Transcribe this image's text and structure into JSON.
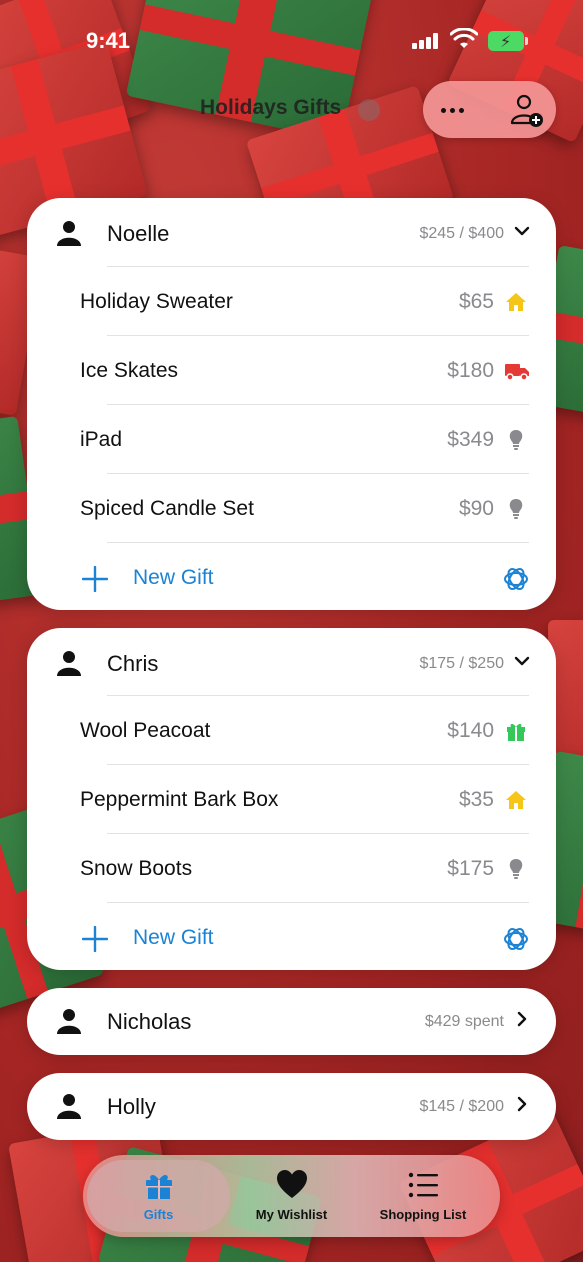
{
  "status_bar": {
    "time": "9:41"
  },
  "header": {
    "title": "Holidays Gifts"
  },
  "people": [
    {
      "name": "Noelle",
      "budget": "$245 / $400",
      "expanded": true,
      "gifts": [
        {
          "name": "Holiday Sweater",
          "price": "$65",
          "status_icon": "house-icon",
          "color": "#f5c518"
        },
        {
          "name": "Ice Skates",
          "price": "$180",
          "status_icon": "truck-icon",
          "color": "#e53935"
        },
        {
          "name": "iPad",
          "price": "$349",
          "status_icon": "lightbulb-icon",
          "color": "#8a8a8e"
        },
        {
          "name": "Spiced Candle Set",
          "price": "$90",
          "status_icon": "lightbulb-icon",
          "color": "#8a8a8e"
        }
      ],
      "new_gift_label": "New Gift"
    },
    {
      "name": "Chris",
      "budget": "$175 / $250",
      "expanded": true,
      "gifts": [
        {
          "name": "Wool Peacoat",
          "price": "$140",
          "status_icon": "gift-icon",
          "color": "#34c759"
        },
        {
          "name": "Peppermint Bark Box",
          "price": "$35",
          "status_icon": "house-icon",
          "color": "#f5c518"
        },
        {
          "name": "Snow Boots",
          "price": "$175",
          "status_icon": "lightbulb-icon",
          "color": "#8a8a8e"
        }
      ],
      "new_gift_label": "New Gift"
    },
    {
      "name": "Nicholas",
      "budget": "$429 spent",
      "expanded": false
    },
    {
      "name": "Holly",
      "budget": "$145 / $200",
      "expanded": false
    }
  ],
  "tabbar": {
    "tabs": [
      {
        "label": "Gifts",
        "icon": "gift-icon",
        "active": true
      },
      {
        "label": "My Wishlist",
        "icon": "heart-icon",
        "active": false
      },
      {
        "label": "Shopping List",
        "icon": "list-icon",
        "active": false
      }
    ]
  },
  "colors": {
    "accent": "#1c83d4",
    "secondary_text": "#8a8a8e"
  }
}
